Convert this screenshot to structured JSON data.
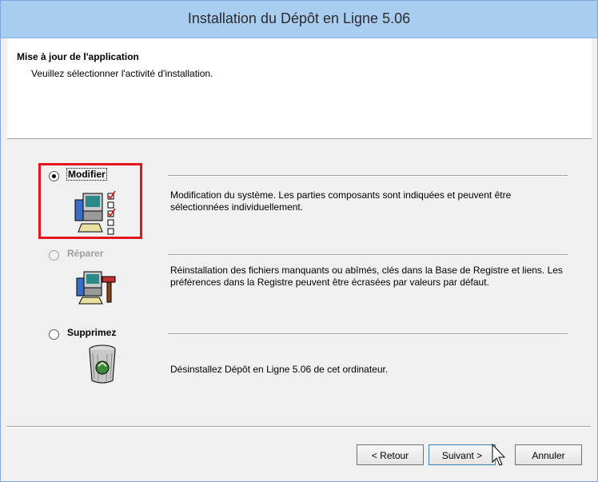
{
  "window": {
    "title": "Installation du Dépôt en Ligne 5.06"
  },
  "header": {
    "title": "Mise à jour de l'application",
    "subtitle": "Veuillez sélectionner l'activité d'installation."
  },
  "options": [
    {
      "label": "Modifier",
      "selected": true,
      "enabled": true,
      "icon": "modify-icon",
      "description": "Modification du système. Les parties composants sont indiquées et peuvent être sélectionnées individuellement."
    },
    {
      "label": "Réparer",
      "selected": false,
      "enabled": false,
      "icon": "repair-icon",
      "description": "Réinstallation des fichiers manquants ou abîmés, clés dans la Base de Registre et liens. Les préférences dans la Registre peuvent être écrasées par valeurs par défaut."
    },
    {
      "label": "Supprimez",
      "selected": false,
      "enabled": true,
      "icon": "recycle-bin-icon",
      "description": "Désinstallez Dépôt en Ligne 5.06 de cet ordinateur."
    }
  ],
  "buttons": {
    "back": "< Retour",
    "next": "Suivant >",
    "cancel": "Annuler"
  },
  "colors": {
    "titlebar": "#a9cdf0",
    "highlight": "#e2141c"
  }
}
